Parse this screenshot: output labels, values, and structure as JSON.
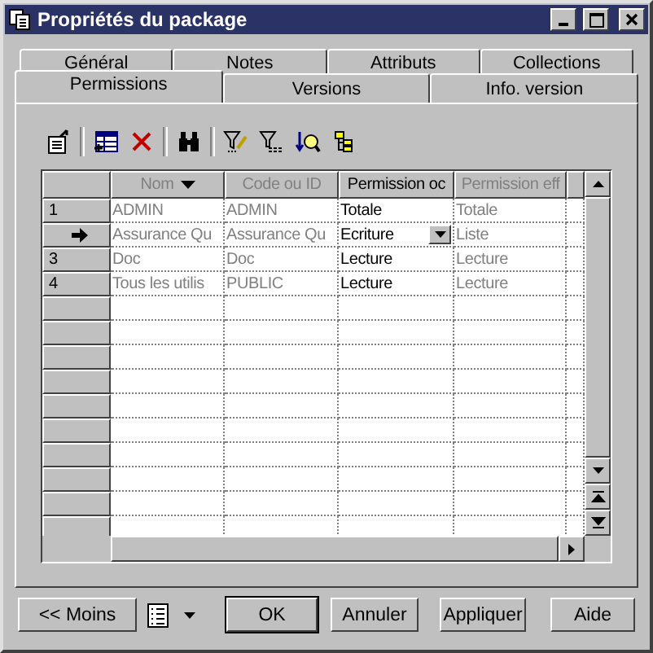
{
  "window": {
    "title": "Propriétés du package"
  },
  "tabs": [
    [
      {
        "label": "Général",
        "selected": false
      },
      {
        "label": "Notes",
        "selected": false
      },
      {
        "label": "Attributs",
        "selected": false
      },
      {
        "label": "Collections",
        "selected": false
      }
    ],
    [
      {
        "label": "Permissions",
        "selected": true
      },
      {
        "label": "Versions",
        "selected": false
      },
      {
        "label": "Info. version",
        "selected": false
      }
    ]
  ],
  "grid": {
    "columns": [
      {
        "label": "Nom",
        "editable": false,
        "sorted": true
      },
      {
        "label": "Code ou ID",
        "editable": false,
        "sorted": false
      },
      {
        "label": "Permission oc",
        "editable": true,
        "sorted": false
      },
      {
        "label": "Permission eff",
        "editable": false,
        "sorted": false
      }
    ],
    "rows": [
      {
        "number": "1",
        "current": false,
        "cells": [
          "ADMIN",
          "ADMIN",
          "Totale",
          "Totale"
        ]
      },
      {
        "current": true,
        "cells": [
          "Assurance Qu",
          "Assurance Qu",
          "Ecriture",
          "Liste"
        ]
      },
      {
        "number": "3",
        "current": false,
        "cells": [
          "Doc",
          "Doc",
          "Lecture",
          "Lecture"
        ]
      },
      {
        "number": "4",
        "current": false,
        "cells": [
          "Tous les utilis",
          "PUBLIC",
          "Lecture",
          "Lecture"
        ]
      }
    ]
  },
  "buttons": [
    {
      "label": "<< Moins",
      "default": false
    },
    {
      "label": "OK",
      "default": true
    },
    {
      "label": "Annuler",
      "default": false
    },
    {
      "label": "Appliquer",
      "default": false
    },
    {
      "label": "Aide",
      "default": false
    }
  ]
}
